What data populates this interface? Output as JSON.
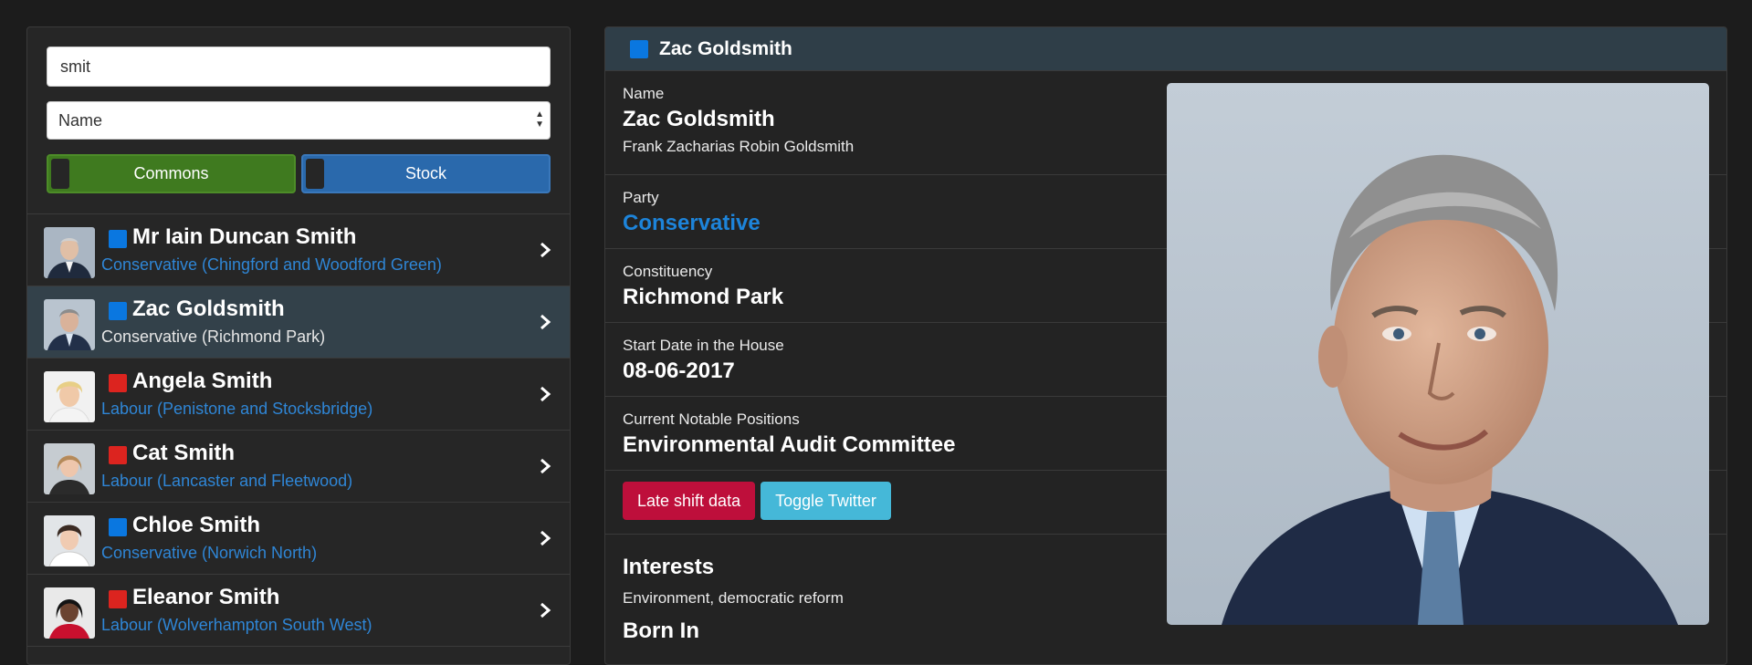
{
  "filters": {
    "search_value": "smit",
    "sort_select": "Name",
    "toggle_commons": "Commons",
    "toggle_stock": "Stock"
  },
  "members": [
    {
      "name": "Mr Iain Duncan Smith",
      "sub": "Conservative (Chingford and Woodford Green)",
      "party_color": "#0a77e0"
    },
    {
      "name": "Zac Goldsmith",
      "sub": "Conservative (Richmond Park)",
      "party_color": "#0a77e0",
      "active": true
    },
    {
      "name": "Angela Smith",
      "sub": "Labour (Penistone and Stocksbridge)",
      "party_color": "#dc241f"
    },
    {
      "name": "Cat Smith",
      "sub": "Labour (Lancaster and Fleetwood)",
      "party_color": "#dc241f"
    },
    {
      "name": "Chloe Smith",
      "sub": "Conservative (Norwich North)",
      "party_color": "#0a77e0"
    },
    {
      "name": "Eleanor Smith",
      "sub": "Labour (Wolverhampton South West)",
      "party_color": "#dc241f"
    }
  ],
  "detail": {
    "header_title": "Zac Goldsmith",
    "name_label": "Name",
    "name_value": "Zac Goldsmith",
    "full_name": "Frank Zacharias Robin Goldsmith",
    "party_label": "Party",
    "party_value": "Conservative",
    "constituency_label": "Constituency",
    "constituency_value": "Richmond Park",
    "start_label": "Start Date in the House",
    "start_value": "08-06-2017",
    "positions_label": "Current Notable Positions",
    "positions_value": "Environmental Audit Committee",
    "late_shift_button": "Late shift data",
    "toggle_twitter_button": "Toggle Twitter",
    "interests_title": "Interests",
    "interests_value": "Environment, democratic reform",
    "born_in_title": "Born In"
  },
  "colors": {
    "conservative": "#0a77e0",
    "labour": "#dc241f",
    "commons_toggle": "#3f7a1f",
    "stock_toggle": "#2a69ac",
    "late_shift": "#be0f3b",
    "twitter": "#45b8d8"
  }
}
